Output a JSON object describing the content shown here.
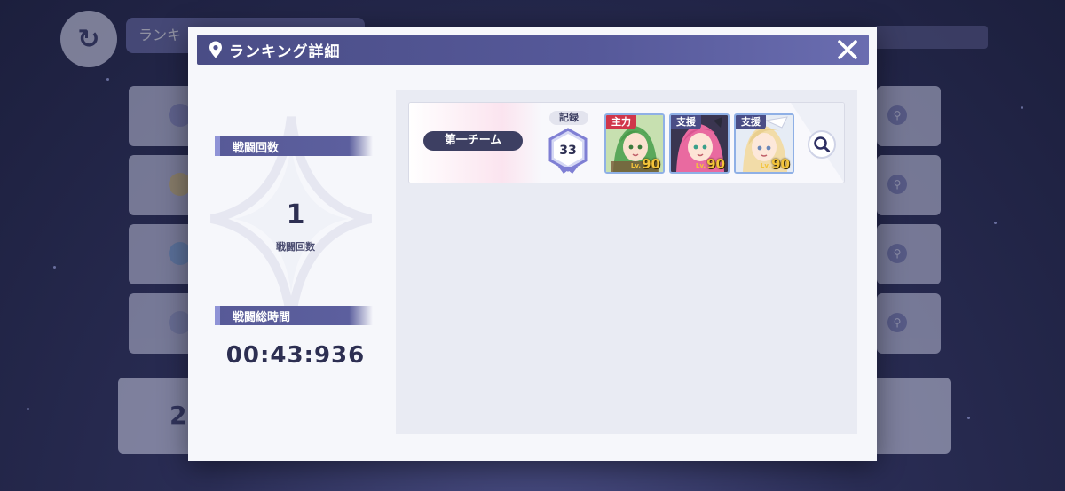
{
  "background": {
    "back_glyph": "↻",
    "location_label": "ランキ",
    "topright_label": "",
    "bottom_number": "2",
    "footnote": ""
  },
  "modal": {
    "title": "ランキング詳細",
    "close_icon": "close-x",
    "stats": {
      "battle_count_header": "戦闘回数",
      "battle_count_value": "1",
      "battle_count_caption": "戦闘回数",
      "total_time_header": "戦闘総時間",
      "total_time_value": "00:43:936"
    },
    "team": {
      "label": "第一チーム",
      "record_label": "記録",
      "record_value": "33",
      "characters": [
        {
          "role": "主力",
          "level": "90",
          "level_prefix": "Lv.",
          "role_color": "#d0364a",
          "portrait": "green-hair"
        },
        {
          "role": "支援",
          "level": "90",
          "level_prefix": "Lv.",
          "role_color": "#4a4d86",
          "portrait": "pink-hair"
        },
        {
          "role": "支援",
          "level": "90",
          "level_prefix": "Lv.",
          "role_color": "#4a4d86",
          "portrait": "blonde-hair"
        }
      ],
      "search_icon": "magnifier"
    }
  },
  "colors": {
    "header": "#4a4d86",
    "accent_bar": "#575a97",
    "text_dark": "#2d2f52",
    "level_gold": "#f3c43a"
  }
}
